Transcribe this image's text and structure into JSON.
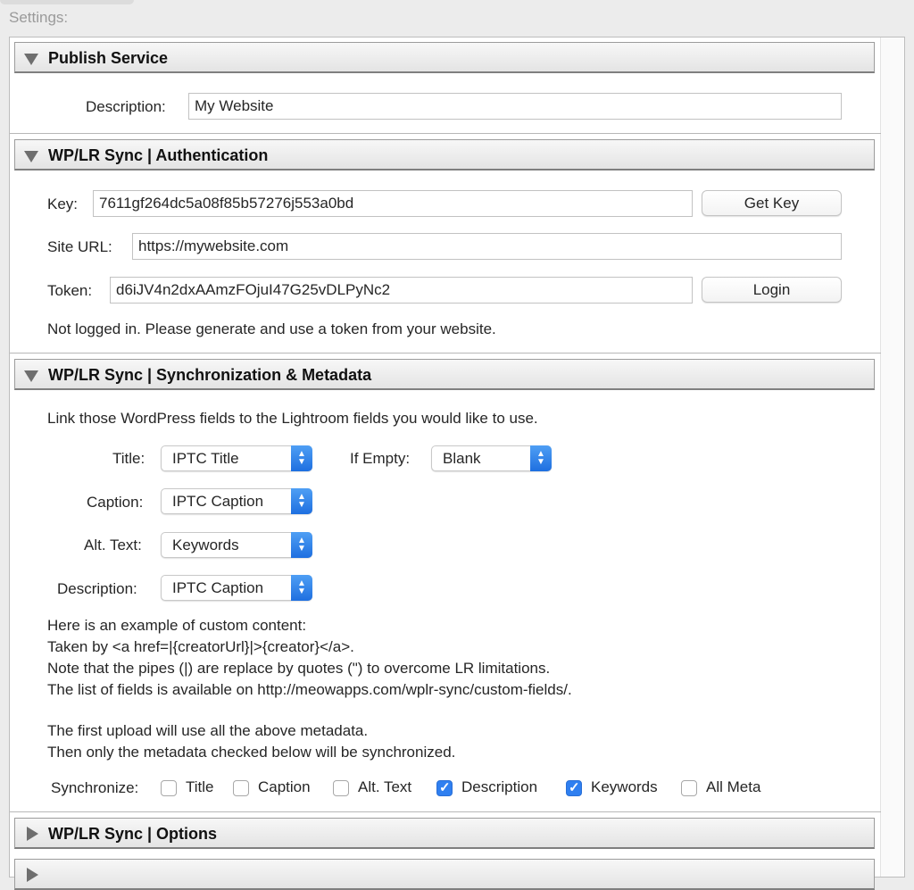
{
  "window": {
    "settings_label": "Settings:"
  },
  "publish_service": {
    "title": "Publish Service",
    "description_label": "Description:",
    "description_value": "My Website"
  },
  "authentication": {
    "title": "WP/LR Sync | Authentication",
    "key_label": "Key:",
    "key_value": "7611gf264dc5a08f85b57276j553a0bd",
    "get_key_button": "Get Key",
    "site_url_label": "Site URL:",
    "site_url_value": "https://mywebsite.com",
    "token_label": "Token:",
    "token_value": "d6iJV4n2dxAAmzFOjuI47G25vDLPyNc2",
    "login_button": "Login",
    "status_text": "Not logged in. Please generate and use a token from your website."
  },
  "sync_metadata": {
    "title": "WP/LR Sync | Synchronization & Metadata",
    "intro": "Link those WordPress fields to the Lightroom fields you would like to use.",
    "title_label": "Title:",
    "title_select": "IPTC Title",
    "if_empty_label": "If Empty:",
    "if_empty_select": "Blank",
    "caption_label": "Caption:",
    "caption_select": "IPTC Caption",
    "alt_text_label": "Alt. Text:",
    "alt_text_select": "Keywords",
    "description_label": "Description:",
    "description_select": "IPTC Caption",
    "help_lines": [
      "Here is an example of custom content:",
      "Taken by <a href=|{creatorUrl}|>{creator}</a>.",
      "Note that the pipes (|) are replace by quotes (\") to overcome LR limitations.",
      "The list of fields is available on http://meowapps.com/wplr-sync/custom-fields/."
    ],
    "upload_lines": [
      "The first upload will use all the above metadata.",
      "Then only the metadata checked below will be synchronized."
    ],
    "synchronize_label": "Synchronize:",
    "checkboxes": [
      {
        "label": "Title",
        "checked": false
      },
      {
        "label": "Caption",
        "checked": false
      },
      {
        "label": "Alt. Text",
        "checked": false
      },
      {
        "label": "Description",
        "checked": true
      },
      {
        "label": "Keywords",
        "checked": true
      },
      {
        "label": "All Meta",
        "checked": false
      }
    ]
  },
  "options": {
    "title": "WP/LR Sync | Options"
  },
  "colors": {
    "accent": "#2f7ff0",
    "header_bg": "#e8e8e8",
    "panel_bg": "#ffffff"
  }
}
